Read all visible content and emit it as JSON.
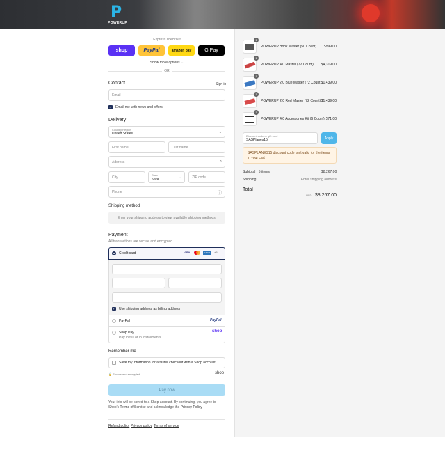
{
  "brand": {
    "logo_letter": "P",
    "logo_text": "POWERUP"
  },
  "express": {
    "label": "Express checkout",
    "buttons": [
      {
        "label": "shop",
        "bg": "#5a31f4",
        "fg": "#ffffff"
      },
      {
        "label": "PayPal",
        "bg": "#ffc439",
        "fg": "#253b80"
      },
      {
        "label": "amazon pay",
        "bg": "#ffd814",
        "fg": "#111111"
      },
      {
        "label": "G Pay",
        "bg": "#000000",
        "fg": "#ffffff"
      }
    ],
    "show_more": "Show more options",
    "or": "OR"
  },
  "contact": {
    "heading": "Contact",
    "sign_in": "Sign in",
    "email_placeholder": "Email",
    "email_news": "Email me with news and offers"
  },
  "delivery": {
    "heading": "Delivery",
    "country_label": "Country/Region",
    "country_value": "United States",
    "first_name": "First name",
    "last_name": "Last name",
    "address": "Address",
    "city": "City",
    "state_label": "State",
    "state_value": "Iowa",
    "zip": "ZIP code",
    "phone": "Phone"
  },
  "shipping_method": {
    "heading": "Shipping method",
    "note": "Enter your shipping address to view available shipping methods."
  },
  "payment": {
    "heading": "Payment",
    "subtitle": "All transactions are secure and encrypted.",
    "credit_card": "Credit card",
    "card_brands": [
      "VISA",
      "MC",
      "AMEX",
      "+5"
    ],
    "billing_same": "Use shipping address as billing address",
    "paypal": "PayPal",
    "paypal_logo": "PayPal",
    "shop_pay": "Shop Pay",
    "shop_pay_sub": "Pay in full or in installments",
    "shop_pay_logo": "shop"
  },
  "remember": {
    "heading": "Remember me",
    "save_info": "Save my information for a faster checkout with a Shop account",
    "secure": "Secure and encrypted",
    "shop_logo": "shop"
  },
  "pay_now": "Pay now",
  "legal": {
    "line1": "Your info will be saved to a Shop account. By continuing, you agree to Shop's",
    "terms": "Terms of Service",
    "and_ack": "and acknowledge the",
    "privacy": "Privacy Policy"
  },
  "footer_links": [
    "Refund policy",
    "Privacy policy",
    "Terms of service"
  ],
  "cart": {
    "items": [
      {
        "qty": "1",
        "name": "POWERUP Book Master (50 Count)",
        "price": "$999.00"
      },
      {
        "qty": "1",
        "name": "POWERUP 4.0 Master (72 Count)",
        "price": "$4,319.00"
      },
      {
        "qty": "1",
        "name": "POWERUP 2.0 Blue Master (72 Count)",
        "price": "$1,439.00"
      },
      {
        "qty": "1",
        "name": "POWERUP 2.0 Red Master (72 Count)",
        "price": "$1,439.00"
      },
      {
        "qty": "1",
        "name": "POWERUP 4.0 Accessories Kit (6 Count)",
        "price": "$71.00"
      }
    ],
    "discount_label": "Discount code or gift card",
    "discount_value": "SASPlanes15",
    "apply": "Apply",
    "error": "SASPLANES15 discount code isn't valid for the items in your cart",
    "subtotal_label": "Subtotal · 5 items",
    "subtotal_value": "$8,267.00",
    "shipping_label": "Shipping",
    "shipping_value": "Enter shipping address",
    "total_label": "Total",
    "currency": "USD",
    "total_value": "$8,267.00"
  }
}
